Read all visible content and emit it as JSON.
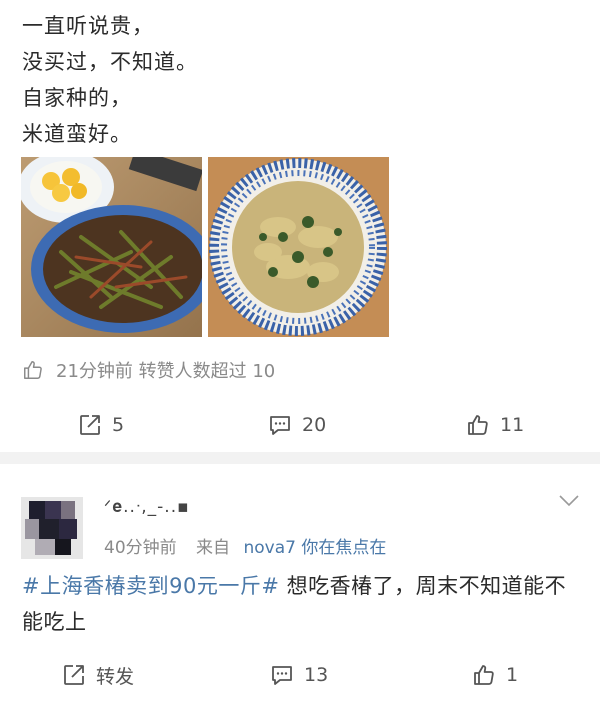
{
  "post": {
    "lines": [
      "一直听说贵，",
      "没买过，不知道。",
      "自家种的，",
      "米道蛮好。"
    ],
    "meta_text": "21分钟前 转赞人数超过 10",
    "actions": {
      "repost": "5",
      "comment": "20",
      "like": "11"
    }
  },
  "reply": {
    "username": "ᐟ𝐞..ᐧ,_-..▪",
    "time": "40分钟前",
    "source_prefix": "来自",
    "device": "nova7 你在焦点在",
    "hashtag": "#上海香椿卖到90元一斤#",
    "body": " 想吃香椿了，周末不知道能不能吃上",
    "actions": {
      "repost": "转发",
      "comment": "13",
      "like": "1"
    }
  },
  "colors": {
    "link": "#4a78a8",
    "meta": "#8a8a8a",
    "separator": "#f2f2f2"
  }
}
